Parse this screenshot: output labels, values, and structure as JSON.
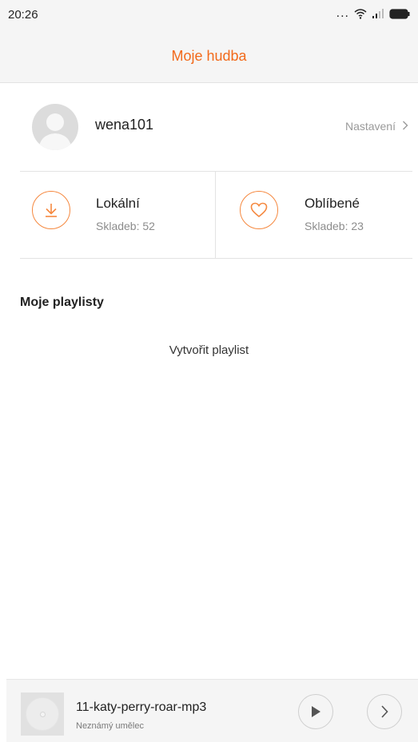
{
  "status_bar": {
    "time": "20:26",
    "dots": "..."
  },
  "header": {
    "title": "Moje hudba"
  },
  "profile": {
    "username": "wena101",
    "settings_label": "Nastavení"
  },
  "cards": {
    "local": {
      "title": "Lokální",
      "subtitle": "Skladeb: 52",
      "icon": "download-icon"
    },
    "favorites": {
      "title": "Oblíbené",
      "subtitle": "Skladeb: 23",
      "icon": "heart-icon"
    }
  },
  "playlists": {
    "section_title": "Moje playlisty",
    "create_label": "Vytvořit playlist"
  },
  "player": {
    "track_title": "11-katy-perry-roar-mp3",
    "artist": "Neznámý umělec"
  },
  "colors": {
    "accent": "#f26a1b",
    "icon_accent": "#f5883f",
    "muted": "#9a9a9a"
  }
}
